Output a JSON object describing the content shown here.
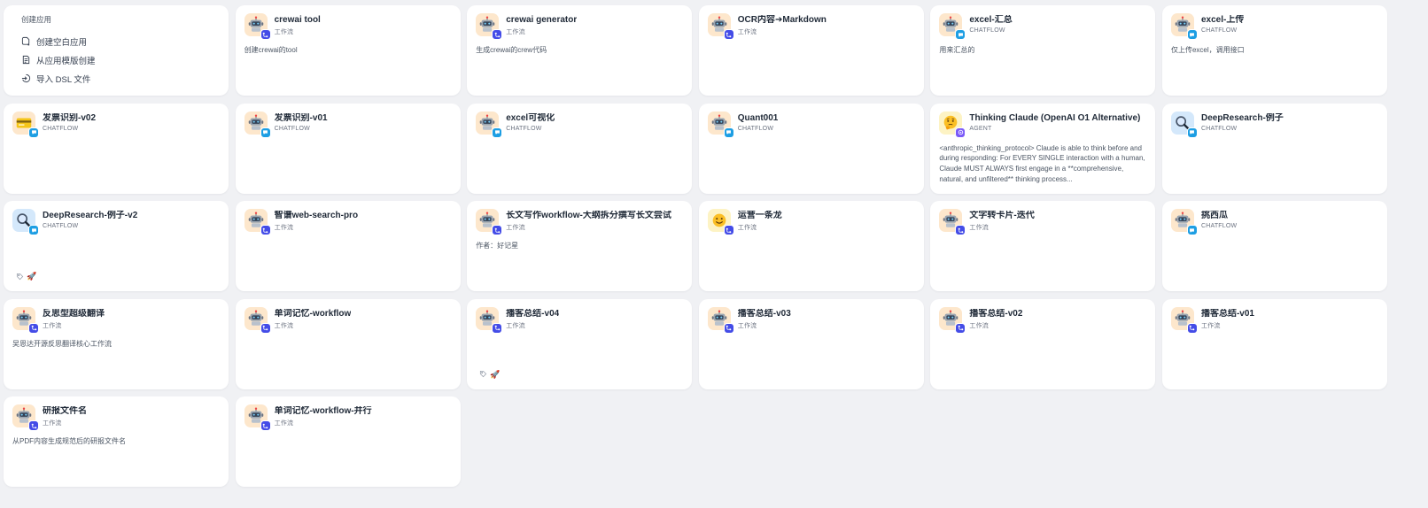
{
  "create": {
    "title": "创建应用",
    "items": [
      {
        "label": "创建空白应用",
        "icon": "blank-app-icon"
      },
      {
        "label": "从应用模版创建",
        "icon": "template-icon"
      },
      {
        "label": "导入 DSL 文件",
        "icon": "import-icon"
      }
    ]
  },
  "colors": {
    "workflow": "#444ce7",
    "chatflow": "#1d9ee3",
    "agent": "#7a5af8"
  },
  "apps": [
    {
      "name": "crewai tool",
      "type": "工作流",
      "kind": "workflow",
      "icon": "robot",
      "desc": "创建crewai的tool"
    },
    {
      "name": "crewai generator",
      "type": "工作流",
      "kind": "workflow",
      "icon": "robot",
      "desc": "生成crewai的crew代码"
    },
    {
      "name": "OCR内容➔Markdown",
      "type": "工作流",
      "kind": "workflow",
      "icon": "robot",
      "desc": ""
    },
    {
      "name": "excel-汇总",
      "type": "CHATFLOW",
      "kind": "chatflow",
      "icon": "robot",
      "desc": "用来汇总的"
    },
    {
      "name": "excel-上传",
      "type": "CHATFLOW",
      "kind": "chatflow",
      "icon": "robot",
      "desc": "仅上传excel，调用接口"
    },
    {
      "name": "发票识别-v02",
      "type": "CHATFLOW",
      "kind": "chatflow",
      "icon": "card",
      "desc": ""
    },
    {
      "name": "发票识别-v01",
      "type": "CHATFLOW",
      "kind": "chatflow",
      "icon": "robot",
      "desc": ""
    },
    {
      "name": "excel可视化",
      "type": "CHATFLOW",
      "kind": "chatflow",
      "icon": "robot",
      "desc": ""
    },
    {
      "name": "Quant001",
      "type": "CHATFLOW",
      "kind": "chatflow",
      "icon": "robot",
      "desc": ""
    },
    {
      "name": "Thinking Claude (OpenAI O1 Alternative)",
      "type": "AGENT",
      "kind": "agent",
      "icon": "thinking",
      "desc": "<anthropic_thinking_protocol> Claude is able to think before and during responding: For EVERY SINGLE interaction with a human, Claude MUST ALWAYS first engage in a **comprehensive, natural, and unfiltered** thinking process..."
    },
    {
      "name": "DeepResearch-例子",
      "type": "CHATFLOW",
      "kind": "chatflow",
      "icon": "magnifier",
      "desc": ""
    },
    {
      "name": "DeepResearch-例子-v2",
      "type": "CHATFLOW",
      "kind": "chatflow",
      "icon": "magnifier",
      "desc": "",
      "tag": "🚀"
    },
    {
      "name": "智谱web-search-pro",
      "type": "工作流",
      "kind": "workflow",
      "icon": "robot",
      "desc": ""
    },
    {
      "name": "长文写作workflow-大纲拆分撰写长文尝试",
      "type": "工作流",
      "kind": "workflow",
      "icon": "robot",
      "desc": "作者：好记星"
    },
    {
      "name": "运营一条龙",
      "type": "工作流",
      "kind": "workflow",
      "icon": "smile",
      "desc": ""
    },
    {
      "name": "文字转卡片-迭代",
      "type": "工作流",
      "kind": "workflow",
      "icon": "robot",
      "desc": ""
    },
    {
      "name": "挑西瓜",
      "type": "CHATFLOW",
      "kind": "chatflow",
      "icon": "robot",
      "desc": ""
    },
    {
      "name": "反思型超级翻译",
      "type": "工作流",
      "kind": "workflow",
      "icon": "robot",
      "desc": "吴恩达开源反思翻译核心工作流"
    },
    {
      "name": "单词记忆-workflow",
      "type": "工作流",
      "kind": "workflow",
      "icon": "robot",
      "desc": ""
    },
    {
      "name": "播客总结-v04",
      "type": "工作流",
      "kind": "workflow",
      "icon": "robot",
      "desc": "",
      "tag": "🚀"
    },
    {
      "name": "播客总结-v03",
      "type": "工作流",
      "kind": "workflow",
      "icon": "robot",
      "desc": ""
    },
    {
      "name": "播客总结-v02",
      "type": "工作流",
      "kind": "workflow",
      "icon": "robot",
      "desc": ""
    },
    {
      "name": "播客总结-v01",
      "type": "工作流",
      "kind": "workflow",
      "icon": "robot",
      "desc": ""
    },
    {
      "name": "研报文件名",
      "type": "工作流",
      "kind": "workflow",
      "icon": "robot",
      "desc": "从PDF内容生成规范后的研报文件名"
    },
    {
      "name": "单词记忆-workflow-并行",
      "type": "工作流",
      "kind": "workflow",
      "icon": "robot",
      "desc": ""
    }
  ]
}
